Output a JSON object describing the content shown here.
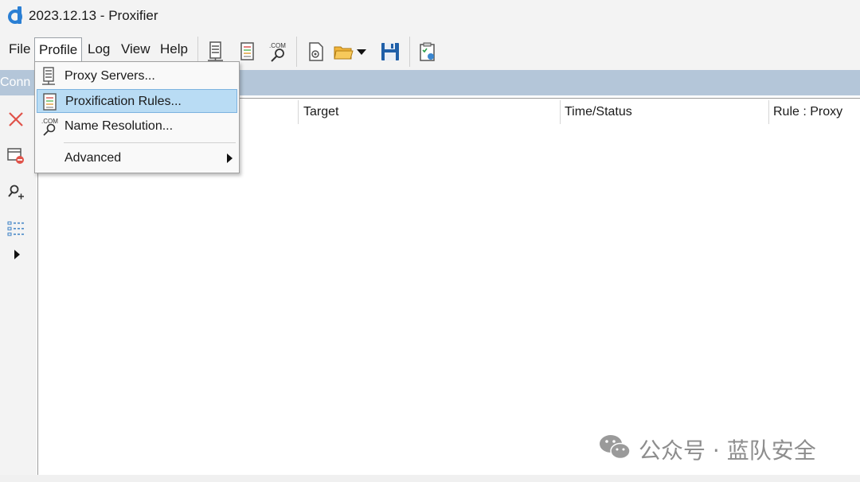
{
  "window": {
    "title": "2023.12.13 - Proxifier"
  },
  "menubar": {
    "items": [
      {
        "label": "File"
      },
      {
        "label": "Profile",
        "open": true
      },
      {
        "label": "Log"
      },
      {
        "label": "View"
      },
      {
        "label": "Help"
      }
    ]
  },
  "toolbar": {
    "buttons": [
      {
        "icon": "proxy-servers-icon"
      },
      {
        "icon": "proxification-rules-icon"
      },
      {
        "icon": "name-resolution-icon",
        "text": ".COM"
      },
      {
        "icon": "new-profile-icon"
      },
      {
        "icon": "open-profile-icon"
      },
      {
        "icon": "save-profile-icon"
      },
      {
        "icon": "clipboard-icon"
      }
    ]
  },
  "panel": {
    "label": "Conn"
  },
  "connections_table": {
    "columns": [
      "Target",
      "Time/Status",
      "Rule : Proxy"
    ],
    "rows": []
  },
  "profile_menu": {
    "items": [
      {
        "label": "Proxy Servers...",
        "icon": "proxy-servers-icon"
      },
      {
        "label": "Proxification Rules...",
        "icon": "proxification-rules-icon",
        "highlighted": true
      },
      {
        "label": "Name Resolution...",
        "icon": "name-resolution-icon",
        "icon_text": ".COM"
      },
      {
        "label": "Advanced",
        "has_submenu": true
      }
    ]
  },
  "watermark": {
    "text": "公众号 · 蓝队安全"
  },
  "colors": {
    "accent_panel": "#b4c6d9",
    "menu_highlight": "#b9dcf4",
    "close_red": "#e0534a"
  }
}
